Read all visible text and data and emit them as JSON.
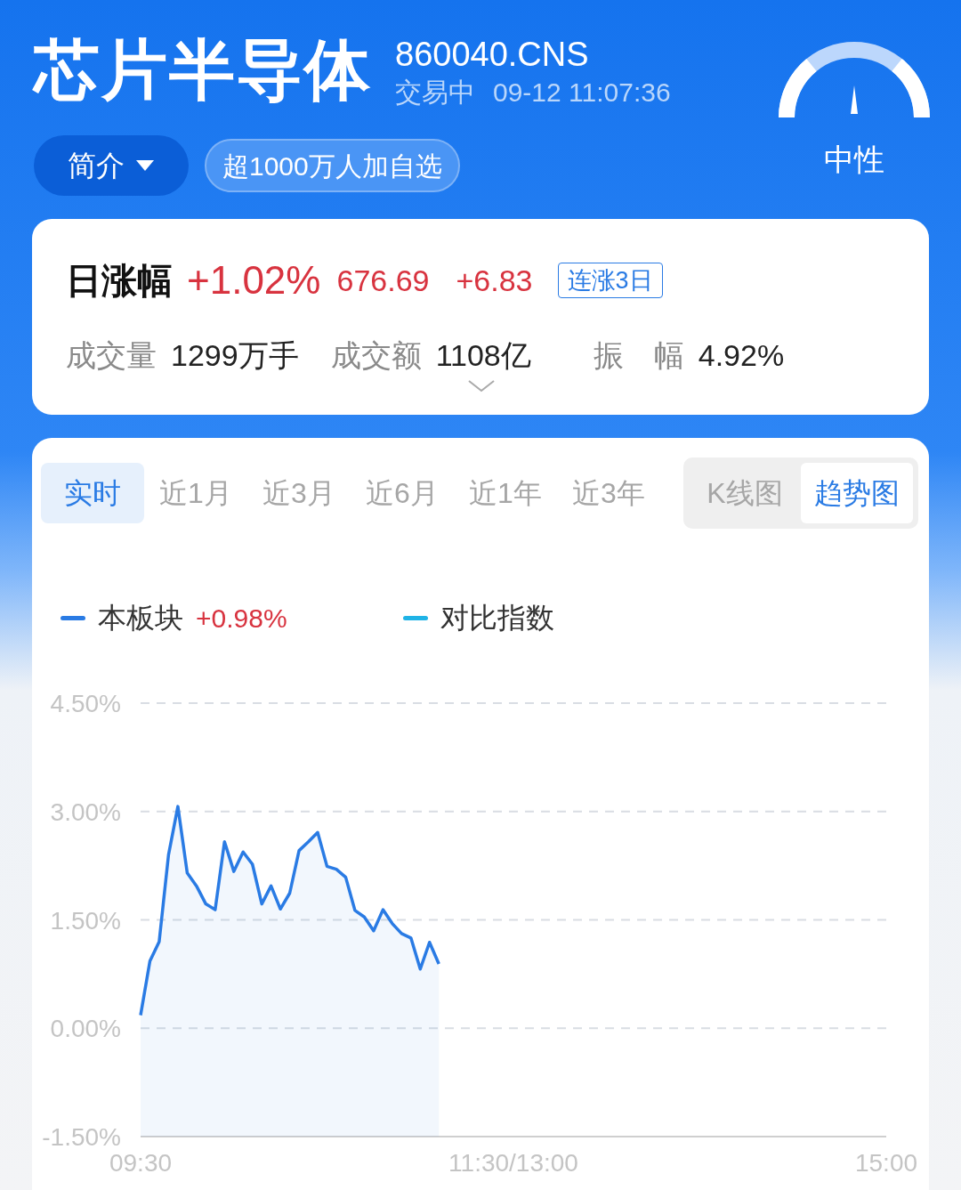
{
  "header": {
    "title": "芯片半导体",
    "code": "860040.CNS",
    "status": "交易中",
    "datetime": "09-12 11:07:36",
    "intro_button": "简介",
    "watchlist_badge": "超1000万人加自选",
    "sentiment": "中性"
  },
  "quote": {
    "label": "日涨幅",
    "change_pct": "+1.02%",
    "price": "676.69",
    "change": "+6.83",
    "streak_tag": "连涨3日",
    "stats": [
      {
        "label": "成交量",
        "value": "1299万手"
      },
      {
        "label": "成交额",
        "value": "1108亿"
      },
      {
        "label": "振　幅",
        "value": "4.92%"
      }
    ]
  },
  "periods": [
    {
      "label": "实时",
      "selected": true
    },
    {
      "label": "近1月",
      "selected": false
    },
    {
      "label": "近3月",
      "selected": false
    },
    {
      "label": "近6月",
      "selected": false
    },
    {
      "label": "近1年",
      "selected": false
    },
    {
      "label": "近3年",
      "selected": false
    }
  ],
  "views": [
    {
      "label": "K线图",
      "selected": false
    },
    {
      "label": "趋势图",
      "selected": true
    }
  ],
  "legend": [
    {
      "value": "+0.98%",
      "color": "#2a7be4"
    },
    {
      "label": "对比指数",
      "color": "#1fb3e6"
    }
  ],
  "chart_data": {
    "type": "line",
    "categories": [
      "09:30",
      null,
      null,
      null,
      null,
      null,
      null,
      null,
      null,
      null,
      null,
      null,
      null,
      null,
      null,
      null,
      null,
      null,
      null,
      null,
      null,
      null,
      null,
      null,
      null,
      null,
      null,
      null,
      null,
      null,
      null,
      null,
      null,
      null,
      null,
      null,
      null,
      null,
      null,
      null,
      "11:30/13:00",
      null,
      null,
      null,
      null,
      null,
      null,
      null,
      null,
      null,
      null,
      null,
      null,
      null,
      null,
      null,
      null,
      null,
      null,
      null,
      null,
      null,
      null,
      null,
      null,
      null,
      null,
      null,
      null,
      null,
      null,
      null,
      null,
      null,
      null,
      null,
      null,
      null,
      null,
      null,
      "15:00"
    ],
    "series": [
      {
        "name": "本板块",
        "color": "#2a7be4",
        "values": [
          0.18,
          0.93,
          1.2,
          2.4,
          3.07,
          2.15,
          1.97,
          1.72,
          1.64,
          2.58,
          2.17,
          2.44,
          2.27,
          1.72,
          1.97,
          1.65,
          1.87,
          2.46,
          2.58,
          2.71,
          2.24,
          2.2,
          2.09,
          1.63,
          1.54,
          1.35,
          1.64,
          1.45,
          1.31,
          1.25,
          0.82,
          1.19,
          0.89,
          null,
          null,
          null,
          null,
          null,
          null,
          null,
          null,
          null,
          null,
          null,
          null,
          null,
          null,
          null,
          null,
          null,
          null,
          null,
          null,
          null,
          null,
          null,
          null,
          null,
          null,
          null,
          null,
          null,
          null,
          null,
          null,
          null,
          null,
          null,
          null,
          null,
          null,
          null,
          null,
          null,
          null,
          null,
          null,
          null,
          null,
          null,
          null
        ]
      }
    ],
    "ylim": [
      -1.5,
      4.5
    ],
    "grid": true,
    "yticks": [
      {
        "value": 4.5,
        "label": "4.50%"
      },
      {
        "value": 3,
        "label": "3.00%"
      },
      {
        "value": 1.5,
        "label": "1.50%"
      },
      {
        "value": 0,
        "label": "0.00%"
      },
      {
        "value": -1.5,
        "label": "-1.50%"
      }
    ]
  }
}
